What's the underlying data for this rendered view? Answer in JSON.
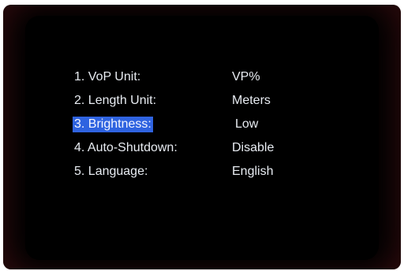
{
  "settings_menu": {
    "items": [
      {
        "label": "1. VoP Unit:",
        "value": "VP%"
      },
      {
        "label": "2. Length Unit:",
        "value": "Meters"
      },
      {
        "label": "3. Brightness:",
        "value": "Low"
      },
      {
        "label": "4. Auto-Shutdown:",
        "value": "Disable"
      },
      {
        "label": "5. Language:",
        "value": "English"
      }
    ],
    "selected_index": 2
  },
  "colors": {
    "screen_background": "#000000",
    "text": "#e8ecf2",
    "highlight": "#2f63e0"
  }
}
